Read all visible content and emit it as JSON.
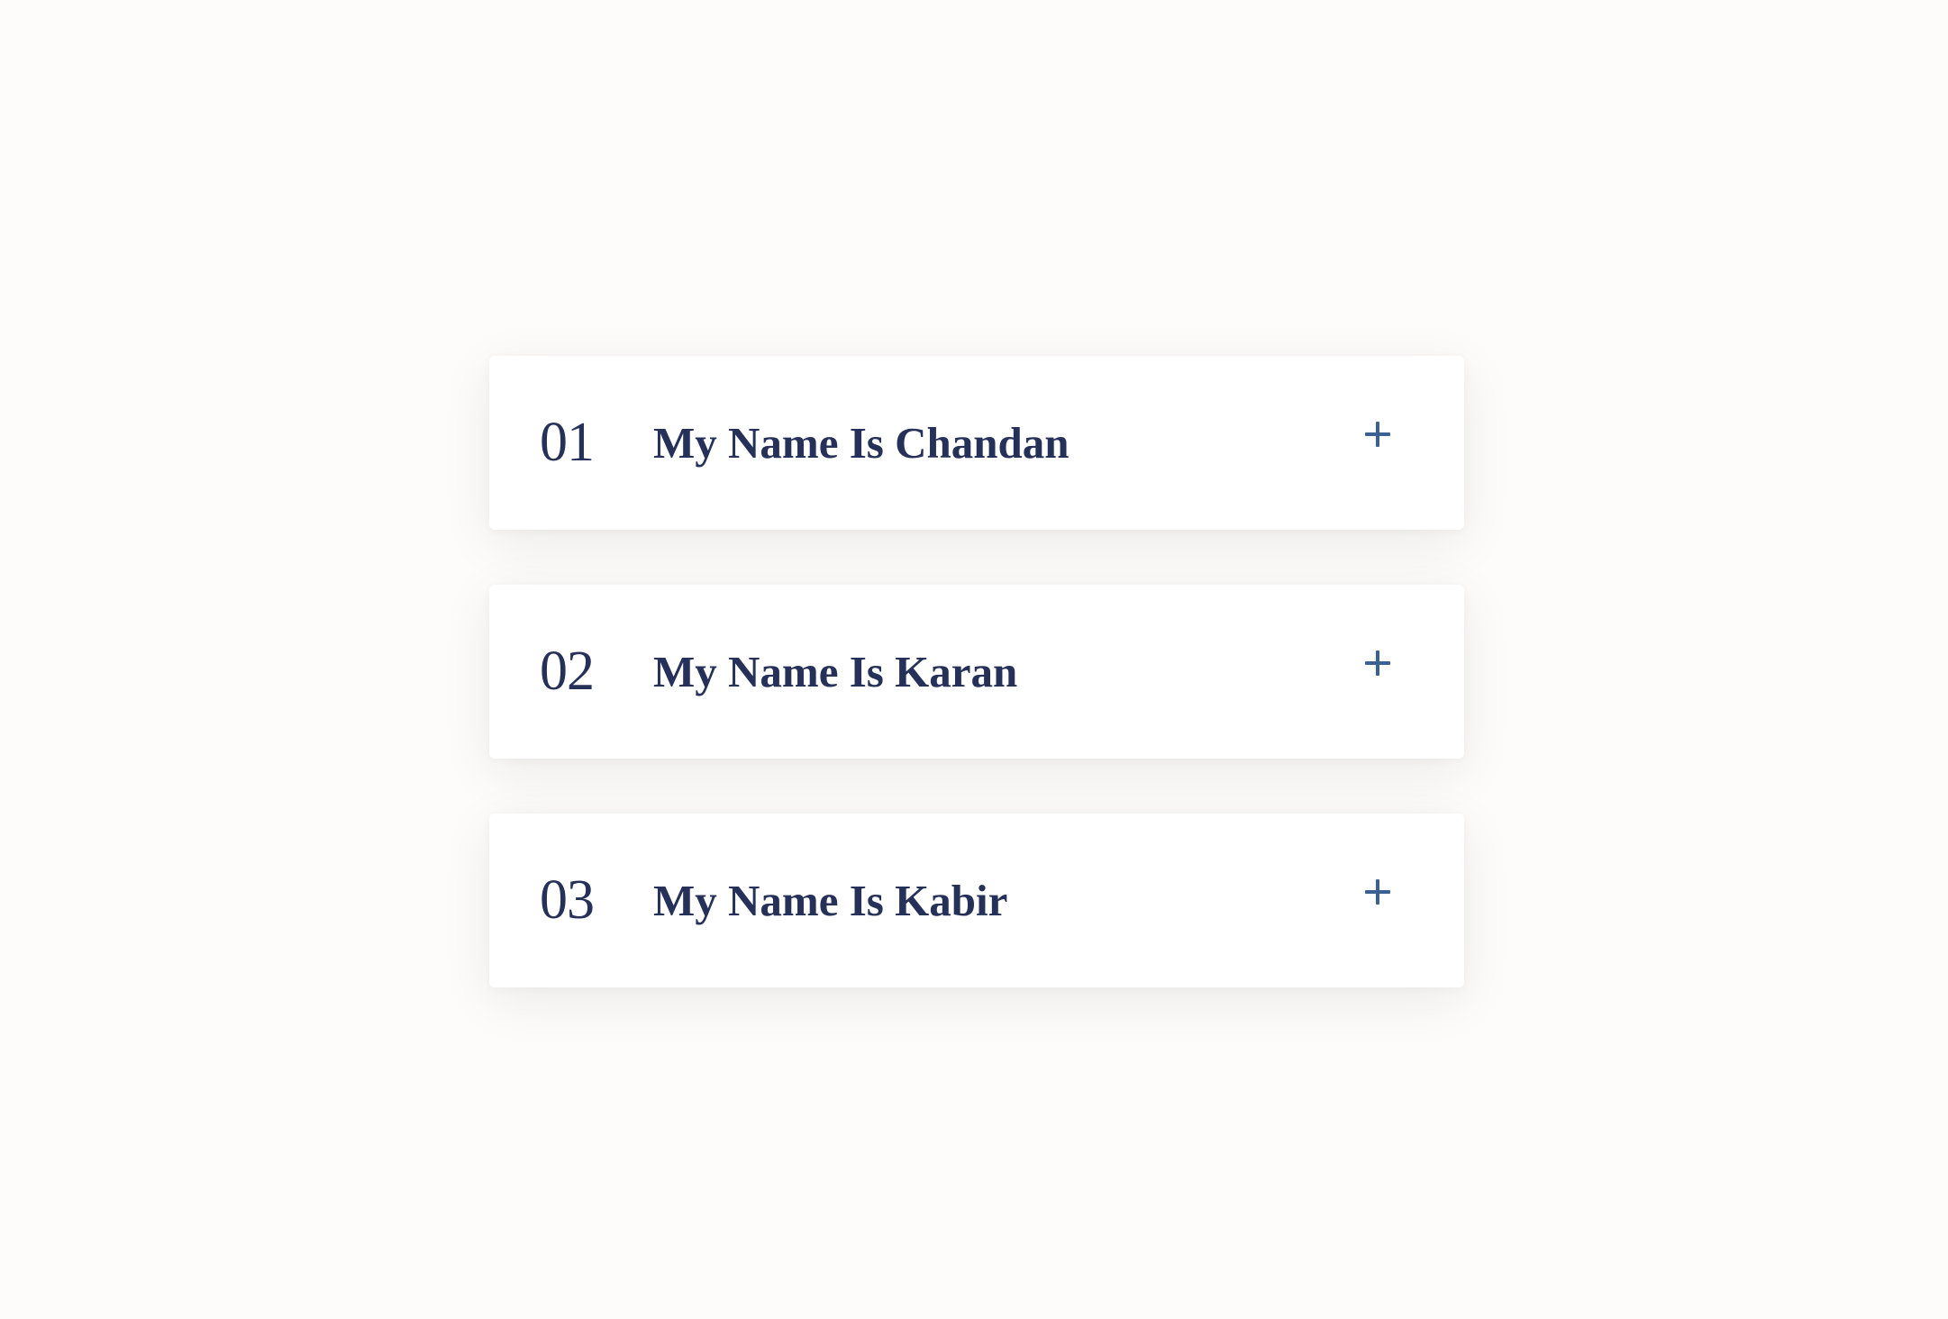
{
  "accordion": {
    "items": [
      {
        "number": "01",
        "title": "My Name Is Chandan",
        "expanded": false,
        "icon": "plus-icon"
      },
      {
        "number": "02",
        "title": "My Name Is Karan",
        "expanded": false,
        "icon": "plus-icon"
      },
      {
        "number": "03",
        "title": "My Name Is Kabir",
        "expanded": false,
        "icon": "plus-icon"
      }
    ]
  },
  "colors": {
    "background": "#fdfcfb",
    "card": "#ffffff",
    "text": "#263159",
    "icon": "#3a6191"
  }
}
